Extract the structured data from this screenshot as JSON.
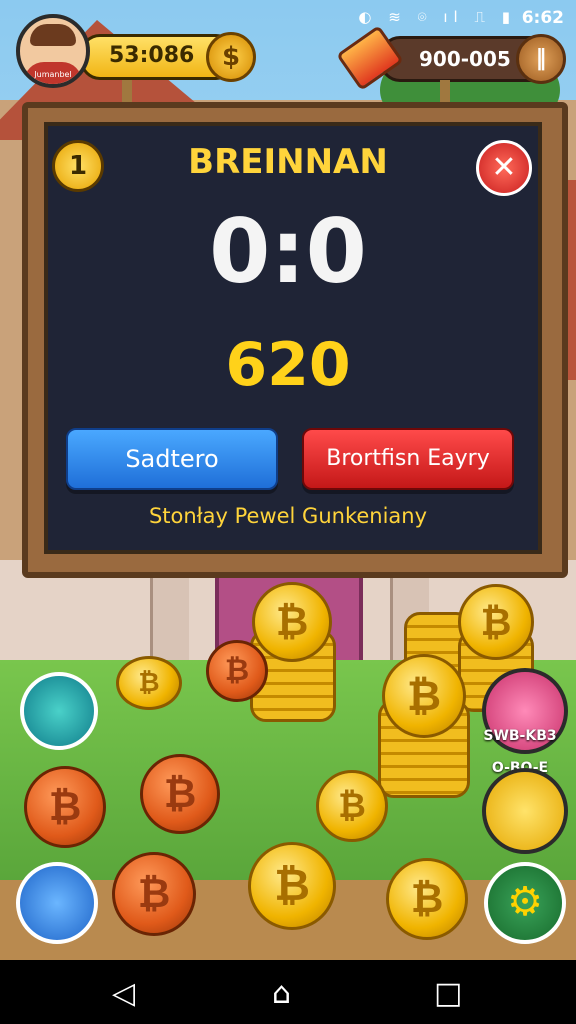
{
  "status_bar": {
    "icons": "◐ ≋ ⌾ ıl ⎍ ▮",
    "time": "6:62"
  },
  "hud": {
    "player_name": "Jumanbel",
    "coins": "53:086",
    "coin_icon": "$",
    "gems": "900-005",
    "gem_add_icon": "‖"
  },
  "board": {
    "level": "1",
    "title": "BREINNAN",
    "score": "0:0",
    "points": "620",
    "close_icon": "✕",
    "button_left": "Sadtero",
    "button_right": "Brortfisn Eayry",
    "subtitle": "Stonłay Pewel Gunkeniany"
  },
  "coins_symbol": "₿",
  "friends": [
    {
      "name": "SWB-KB3"
    },
    {
      "name": "O-BO-E"
    }
  ],
  "nav": {
    "back": "◁",
    "home": "⌂",
    "recents": "□"
  },
  "colors": {
    "board_bg": "#1f2436",
    "title_yellow": "#ffd43b",
    "button_blue": "#1f6fd8",
    "button_red": "#c41818"
  }
}
